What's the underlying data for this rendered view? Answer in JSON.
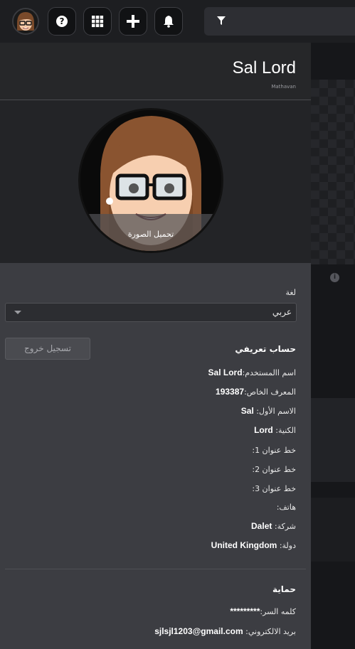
{
  "topbar": {
    "avatar_icon": "avatar-icon",
    "buttons": [
      {
        "name": "help-button",
        "icon": "question-icon"
      },
      {
        "name": "apps-button",
        "icon": "grid-icon"
      },
      {
        "name": "add-button",
        "icon": "plus-icon"
      },
      {
        "name": "notifications-button",
        "icon": "bell-icon"
      }
    ],
    "filter_icon": "filter-icon"
  },
  "profile": {
    "name": "Sal Lord",
    "subtitle": "Mathavan",
    "upload_photo_label": "تحميل الصورة"
  },
  "language": {
    "label": "لغة",
    "selected": "عربي"
  },
  "logout_label": "تسجيل خروج",
  "account": {
    "title": "حساب تعريفي",
    "fields": [
      {
        "label": "اسم االمستخدم:",
        "value": "Sal Lord"
      },
      {
        "label": "المعرف الخاص:",
        "value": "193387"
      },
      {
        "label": "الاسم الأول:",
        "value": "Sal"
      },
      {
        "label": "الكنية:",
        "value": "Lord"
      },
      {
        "label": "خط عنوان 1:",
        "value": ""
      },
      {
        "label": "خط عنوان 2:",
        "value": ""
      },
      {
        "label": "خط عنوان 3:",
        "value": ""
      },
      {
        "label": "هاتف:",
        "value": ""
      },
      {
        "label": "شركة:",
        "value": "Dalet"
      },
      {
        "label": "دولة:",
        "value": "United Kingdom"
      }
    ]
  },
  "security": {
    "title": "حماية",
    "fields": [
      {
        "label": "كلمه السر:",
        "value": "*********"
      },
      {
        "label": "بريد الالكتروني:",
        "value": "sjlsjl1203@gmail.com"
      }
    ]
  },
  "colors": {
    "panel_bg": "#3c3d42",
    "header_bg": "#262729",
    "topbar_bg": "#1d1e21"
  }
}
